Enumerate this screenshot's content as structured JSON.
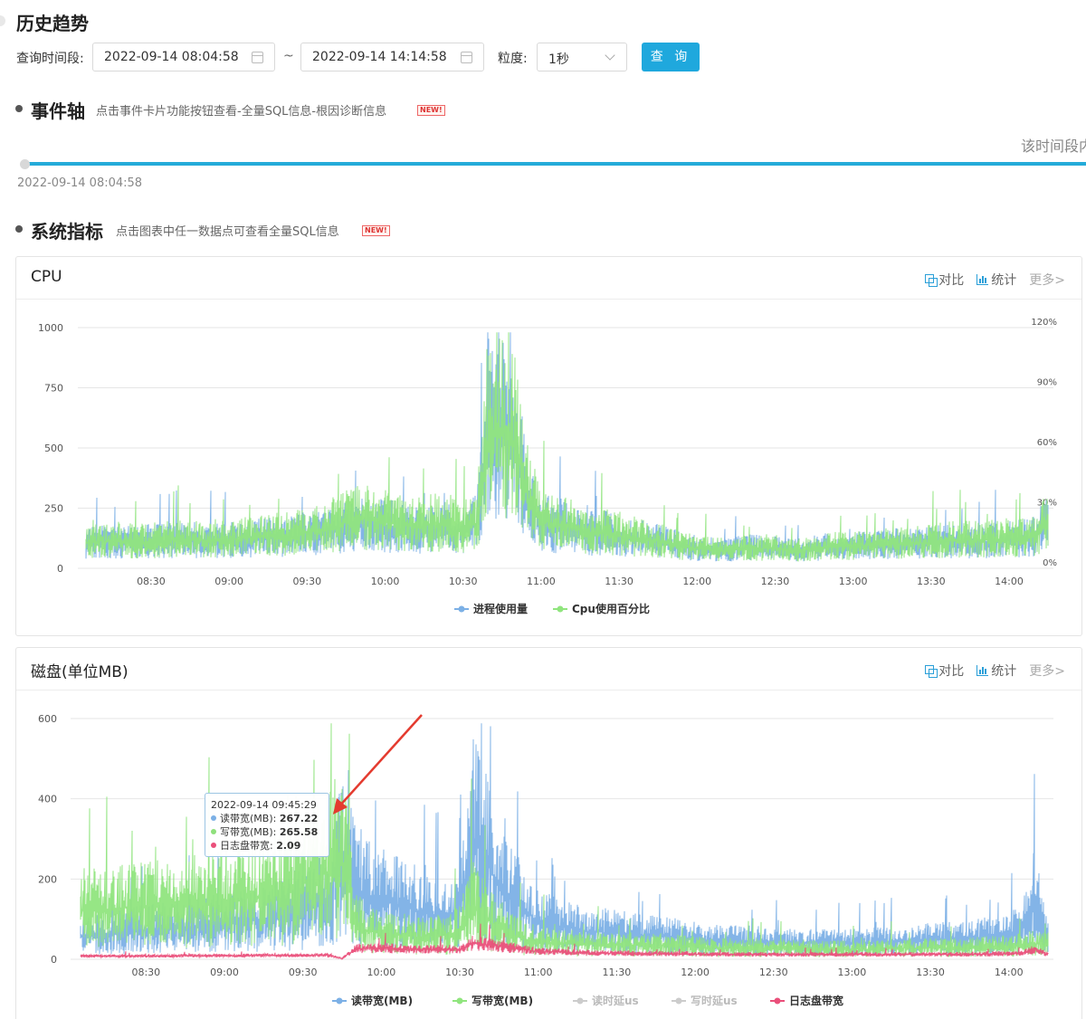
{
  "header": {
    "title": "历史趋势"
  },
  "query": {
    "range_label": "查询时间段:",
    "start": "2022-09-14 08:04:58",
    "separator": "~",
    "end": "2022-09-14 14:14:58",
    "granularity_label": "粒度:",
    "granularity": "1秒",
    "submit": "查 询"
  },
  "events": {
    "title": "事件轴",
    "hint": "点击事件卡片功能按钮查看-全量SQL信息-根因诊断信息",
    "badge": "NEW!",
    "timeline_start": "2022-09-14 08:04:58",
    "right_text": "该时间段内"
  },
  "metrics": {
    "title": "系统指标",
    "hint": "点击图表中任一数据点可查看全量SQL信息",
    "badge": "NEW!"
  },
  "tools": {
    "compare": "对比",
    "stats": "统计",
    "more": "更多>"
  },
  "cpu": {
    "card_title": "CPU"
  },
  "disk": {
    "card_title": "磁盘(单位MB)",
    "tooltip": {
      "time": "2022-09-14 09:45:29",
      "rows": [
        {
          "label": "读带宽(MB):",
          "value": "267.22",
          "color": "#7cb0e6"
        },
        {
          "label": "写带宽(MB):",
          "value": "265.58",
          "color": "#8fe07c"
        },
        {
          "label": "日志盘带宽:",
          "value": "2.09",
          "color": "#ea4f7a"
        }
      ]
    }
  },
  "chart_data": [
    {
      "type": "line",
      "title": "CPU",
      "x_ticks": [
        "08:30",
        "09:00",
        "09:30",
        "10:00",
        "10:30",
        "11:00",
        "11:30",
        "12:00",
        "12:30",
        "13:00",
        "13:30",
        "14:00"
      ],
      "y_ticks_left": [
        "0",
        "250",
        "500",
        "750",
        "1000"
      ],
      "y_ticks_right": [
        "0%",
        "30%",
        "60%",
        "90%",
        "120%"
      ],
      "ylim_left": [
        0,
        1000
      ],
      "ylim_right": [
        0,
        120
      ],
      "x_range": [
        "08:04:58",
        "14:14:58"
      ],
      "legend_position": "bottom",
      "grid": true,
      "series": [
        {
          "name": "进程使用量",
          "color": "#7cb0e6",
          "x": [
            "08:05",
            "08:15",
            "08:25",
            "08:35",
            "08:45",
            "08:55",
            "09:05",
            "09:15",
            "09:25",
            "09:35",
            "09:40",
            "09:45",
            "09:50",
            "09:55",
            "10:00",
            "10:05",
            "10:10",
            "10:15",
            "10:20",
            "10:25",
            "10:30",
            "10:35",
            "10:40",
            "10:45",
            "10:50",
            "10:55",
            "11:00",
            "11:05",
            "11:10",
            "11:15",
            "11:20",
            "11:25",
            "11:30",
            "11:40",
            "11:50",
            "12:00",
            "12:10",
            "12:20",
            "12:30",
            "12:40",
            "12:50",
            "13:00",
            "13:10",
            "13:20",
            "13:30",
            "13:40",
            "13:50",
            "14:00",
            "14:05",
            "14:10",
            "14:14"
          ],
          "y": [
            105,
            110,
            108,
            112,
            115,
            110,
            118,
            125,
            130,
            150,
            160,
            170,
            180,
            175,
            170,
            165,
            160,
            160,
            165,
            160,
            150,
            180,
            540,
            560,
            490,
            280,
            190,
            170,
            160,
            150,
            140,
            145,
            130,
            120,
            100,
            80,
            75,
            85,
            80,
            70,
            90,
            90,
            95,
            100,
            105,
            110,
            110,
            115,
            120,
            130,
            180
          ]
        },
        {
          "name": "Cpu使用百分比",
          "color": "#90e57e",
          "x": [
            "08:05",
            "08:15",
            "08:25",
            "08:35",
            "08:45",
            "08:55",
            "09:05",
            "09:15",
            "09:25",
            "09:35",
            "09:40",
            "09:45",
            "09:50",
            "09:55",
            "10:00",
            "10:05",
            "10:10",
            "10:15",
            "10:20",
            "10:25",
            "10:30",
            "10:35",
            "10:40",
            "10:45",
            "10:50",
            "10:55",
            "11:00",
            "11:05",
            "11:10",
            "11:15",
            "11:20",
            "11:25",
            "11:30",
            "11:40",
            "11:50",
            "12:00",
            "12:10",
            "12:20",
            "12:30",
            "12:40",
            "12:50",
            "13:00",
            "13:10",
            "13:20",
            "13:30",
            "13:40",
            "13:50",
            "14:00",
            "14:05",
            "14:10",
            "14:14"
          ],
          "y": [
            13,
            14,
            13,
            14,
            14,
            14,
            15,
            16,
            17,
            19,
            21,
            23,
            25,
            24,
            23,
            22,
            21,
            22,
            22,
            21,
            20,
            22,
            68,
            70,
            62,
            36,
            24,
            22,
            21,
            19,
            18,
            18,
            16,
            15,
            12,
            10,
            9,
            10,
            10,
            9,
            11,
            11,
            12,
            12,
            13,
            14,
            14,
            15,
            15,
            16,
            22
          ]
        }
      ]
    },
    {
      "type": "line",
      "title": "磁盘(单位MB)",
      "x_ticks": [
        "08:30",
        "09:00",
        "09:30",
        "10:00",
        "10:30",
        "11:00",
        "11:30",
        "12:00",
        "12:30",
        "13:00",
        "13:30",
        "14:00"
      ],
      "y_ticks": [
        "0",
        "200",
        "400",
        "600"
      ],
      "ylim": [
        0,
        600
      ],
      "x_range": [
        "08:04:58",
        "14:14:58"
      ],
      "legend_position": "bottom",
      "grid": true,
      "series": [
        {
          "name": "读带宽(MB)",
          "color": "#7cb0e6",
          "x": [
            "08:05",
            "08:15",
            "08:25",
            "08:35",
            "08:45",
            "08:55",
            "09:05",
            "09:15",
            "09:25",
            "09:35",
            "09:40",
            "09:45",
            "09:50",
            "09:55",
            "10:00",
            "10:05",
            "10:10",
            "10:15",
            "10:20",
            "10:25",
            "10:30",
            "10:35",
            "10:40",
            "10:45",
            "10:50",
            "10:55",
            "11:00",
            "11:10",
            "11:20",
            "11:30",
            "11:40",
            "11:50",
            "12:00",
            "12:10",
            "12:20",
            "12:30",
            "12:40",
            "12:50",
            "13:00",
            "13:10",
            "13:20",
            "13:30",
            "13:40",
            "13:50",
            "14:00",
            "14:05",
            "14:10",
            "14:14"
          ],
          "y": [
            55,
            60,
            70,
            75,
            80,
            85,
            90,
            100,
            110,
            130,
            150,
            267,
            180,
            160,
            150,
            140,
            130,
            120,
            110,
            100,
            110,
            300,
            250,
            180,
            150,
            120,
            90,
            80,
            70,
            65,
            60,
            55,
            50,
            45,
            45,
            42,
            40,
            40,
            40,
            42,
            45,
            48,
            50,
            55,
            60,
            70,
            150,
            60
          ]
        },
        {
          "name": "写带宽(MB)",
          "color": "#90e57e",
          "x": [
            "08:05",
            "08:15",
            "08:25",
            "08:35",
            "08:45",
            "08:55",
            "09:05",
            "09:15",
            "09:25",
            "09:35",
            "09:40",
            "09:45",
            "09:50",
            "09:55",
            "10:00",
            "10:05",
            "10:10",
            "10:15",
            "10:20",
            "10:25",
            "10:30",
            "10:35",
            "10:40",
            "10:45",
            "10:50",
            "10:55",
            "11:00",
            "11:10",
            "11:20",
            "11:30",
            "11:40",
            "11:50",
            "12:00",
            "12:10",
            "12:20",
            "12:30",
            "12:40",
            "12:50",
            "13:00",
            "13:10",
            "13:20",
            "13:30",
            "13:40",
            "13:50",
            "14:00",
            "14:05",
            "14:10",
            "14:14"
          ],
          "y": [
            120,
            125,
            130,
            130,
            135,
            140,
            150,
            160,
            180,
            200,
            220,
            265,
            90,
            70,
            65,
            60,
            60,
            55,
            60,
            60,
            70,
            130,
            100,
            80,
            60,
            50,
            45,
            40,
            38,
            36,
            35,
            34,
            30,
            28,
            28,
            27,
            26,
            25,
            25,
            26,
            27,
            28,
            28,
            30,
            32,
            35,
            40,
            35
          ]
        },
        {
          "name": "读时延us",
          "color": "#cccccc",
          "x": [],
          "y": []
        },
        {
          "name": "写时延us",
          "color": "#cccccc",
          "x": [],
          "y": []
        },
        {
          "name": "日志盘带宽",
          "color": "#ea4f7a",
          "x": [
            "08:05",
            "08:15",
            "08:25",
            "08:35",
            "08:45",
            "08:55",
            "09:05",
            "09:15",
            "09:25",
            "09:35",
            "09:40",
            "09:45",
            "09:50",
            "09:55",
            "10:00",
            "10:05",
            "10:10",
            "10:15",
            "10:20",
            "10:25",
            "10:30",
            "10:35",
            "10:40",
            "10:45",
            "10:50",
            "10:55",
            "11:00",
            "11:10",
            "11:20",
            "11:30",
            "11:40",
            "11:50",
            "12:00",
            "12:10",
            "12:20",
            "12:30",
            "12:40",
            "12:50",
            "13:00",
            "13:10",
            "13:20",
            "13:30",
            "13:40",
            "13:50",
            "14:00",
            "14:05",
            "14:10",
            "14:14"
          ],
          "y": [
            8,
            8,
            8,
            8,
            9,
            9,
            9,
            10,
            10,
            10,
            10,
            2,
            25,
            28,
            28,
            26,
            25,
            25,
            24,
            24,
            25,
            40,
            36,
            32,
            28,
            24,
            20,
            18,
            16,
            15,
            14,
            14,
            13,
            12,
            12,
            12,
            12,
            12,
            12,
            12,
            12,
            12,
            12,
            13,
            14,
            15,
            25,
            14
          ]
        }
      ]
    }
  ]
}
